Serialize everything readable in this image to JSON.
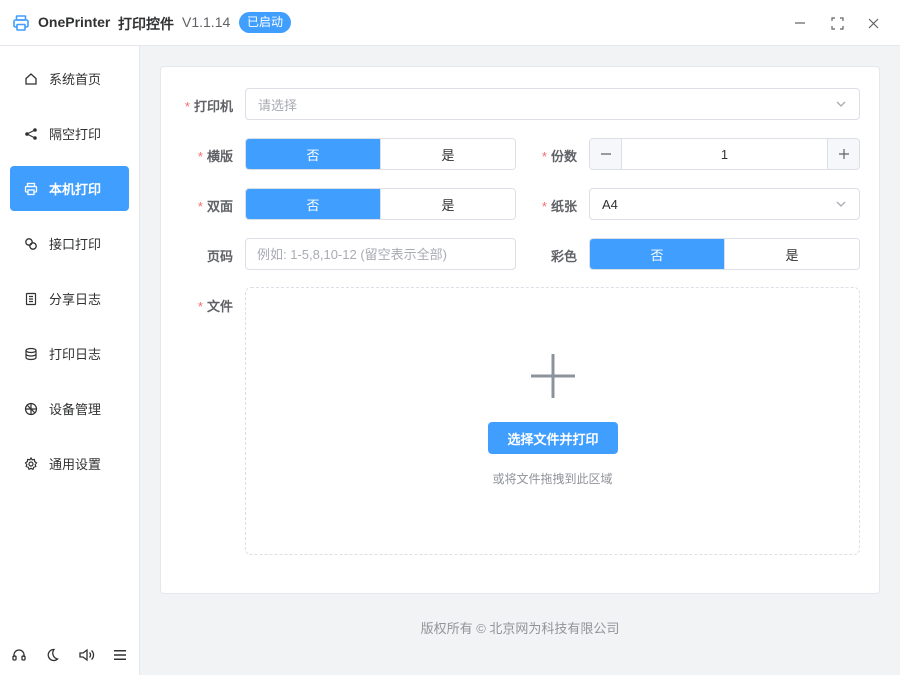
{
  "titlebar": {
    "app_name": "OnePrinter",
    "app_sub": "打印控件",
    "version": "V1.1.14",
    "status": "已启动"
  },
  "sidebar": {
    "items": [
      {
        "label": "系统首页",
        "icon": "home-icon"
      },
      {
        "label": "隔空打印",
        "icon": "share-icon"
      },
      {
        "label": "本机打印",
        "icon": "printer-icon"
      },
      {
        "label": "接口打印",
        "icon": "link-icon"
      },
      {
        "label": "分享日志",
        "icon": "document-icon"
      },
      {
        "label": "打印日志",
        "icon": "database-icon"
      },
      {
        "label": "设备管理",
        "icon": "device-icon"
      },
      {
        "label": "通用设置",
        "icon": "gear-icon"
      }
    ],
    "active_index": 2,
    "footer_icons": [
      "headset-icon",
      "moon-icon",
      "volume-icon",
      "menu-icon"
    ]
  },
  "form": {
    "printer": {
      "label": "打印机",
      "placeholder": "请选择"
    },
    "landscape": {
      "label": "横版",
      "options": [
        "否",
        "是"
      ],
      "selected": "否"
    },
    "copies": {
      "label": "份数",
      "value": "1"
    },
    "duplex": {
      "label": "双面",
      "options": [
        "否",
        "是"
      ],
      "selected": "否"
    },
    "paper": {
      "label": "纸张",
      "value": "A4"
    },
    "pages": {
      "label": "页码",
      "placeholder": "例如: 1-5,8,10-12 (留空表示全部)"
    },
    "color": {
      "label": "彩色",
      "options": [
        "否",
        "是"
      ],
      "selected": "否"
    },
    "file": {
      "label": "文件",
      "button": "选择文件并打印",
      "hint": "或将文件拖拽到此区域"
    }
  },
  "footer": {
    "copyright": "版权所有 ©  北京网为科技有限公司"
  },
  "colors": {
    "accent": "#409eff",
    "required": "#f56c6c",
    "background": "#f2f3f5"
  }
}
